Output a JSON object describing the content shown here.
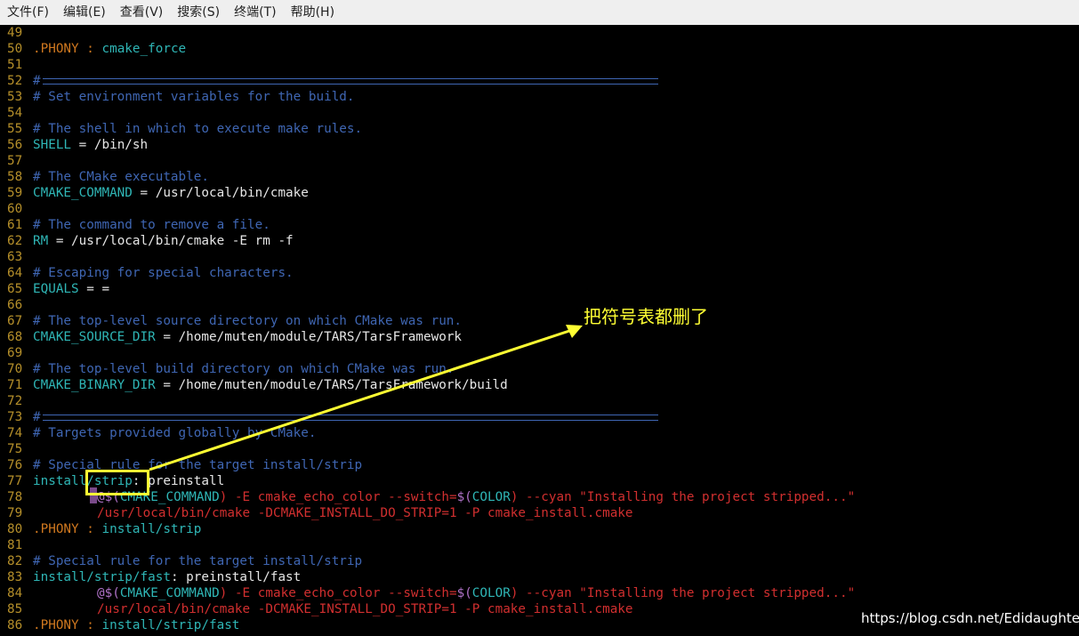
{
  "menubar": {
    "items": [
      "文件(F)",
      "编辑(E)",
      "查看(V)",
      "搜索(S)",
      "终端(T)",
      "帮助(H)"
    ]
  },
  "lines": {
    "l49": {
      "num": "49"
    },
    "l50": {
      "num": "50",
      "a": ".PHONY",
      "b": " : ",
      "c": "cmake_force"
    },
    "l51": {
      "num": "51"
    },
    "l52": {
      "num": "52",
      "a": "#"
    },
    "l53": {
      "num": "53",
      "a": "# Set environment variables for the build."
    },
    "l54": {
      "num": "54"
    },
    "l55": {
      "num": "55",
      "a": "# The shell in which to execute make rules."
    },
    "l56": {
      "num": "56",
      "a": "SHELL",
      "b": " = ",
      "c": "/bin/sh"
    },
    "l57": {
      "num": "57"
    },
    "l58": {
      "num": "58",
      "a": "# The CMake executable."
    },
    "l59": {
      "num": "59",
      "a": "CMAKE_COMMAND",
      "b": " = ",
      "c": "/usr/local/bin/cmake"
    },
    "l60": {
      "num": "60"
    },
    "l61": {
      "num": "61",
      "a": "# The command to remove a file."
    },
    "l62": {
      "num": "62",
      "a": "RM",
      "b": " = ",
      "c": "/usr/local/bin/cmake -E rm -f"
    },
    "l63": {
      "num": "63"
    },
    "l64": {
      "num": "64",
      "a": "# Escaping for special characters."
    },
    "l65": {
      "num": "65",
      "a": "EQUALS",
      "b": " = ",
      "c": "="
    },
    "l66": {
      "num": "66"
    },
    "l67": {
      "num": "67",
      "a": "# The top-level source directory on which CMake was run."
    },
    "l68": {
      "num": "68",
      "a": "CMAKE_SOURCE_DIR",
      "b": " = ",
      "c": "/home/muten/module/TARS/TarsFramework"
    },
    "l69": {
      "num": "69"
    },
    "l70": {
      "num": "70",
      "a": "# The top-level build directory on which CMake was run."
    },
    "l71": {
      "num": "71",
      "a": "CMAKE_BINARY_DIR",
      "b": " = ",
      "c": "/home/muten/module/TARS/TarsFramework/build"
    },
    "l72": {
      "num": "72"
    },
    "l73": {
      "num": "73",
      "a": "#"
    },
    "l74": {
      "num": "74",
      "a": "# Targets provided globally by CMake."
    },
    "l75": {
      "num": "75"
    },
    "l76": {
      "num": "76",
      "a": "# Special rule for the target install/strip"
    },
    "l77": {
      "num": "77",
      "a": "install/strip",
      "b": ": ",
      "c": "preinstall"
    },
    "l78": {
      "num": "78",
      "a": "@",
      "b": "$(",
      "c": "CMAKE_COMMAND",
      "d": ") -E cmake_echo_color --switch=",
      "e": "$(",
      "f": "COLOR",
      "g": ") --cyan \"Installing the project stripped...\""
    },
    "l79": {
      "num": "79",
      "a": "/usr/local/bin/cmake -DCMAKE_INSTALL_DO_STRIP=1 -P cmake_install.cmake"
    },
    "l80": {
      "num": "80",
      "a": ".PHONY",
      "b": " : ",
      "c": "install/strip"
    },
    "l81": {
      "num": "81"
    },
    "l82": {
      "num": "82",
      "a": "# Special rule for the target install/strip"
    },
    "l83": {
      "num": "83",
      "a": "install/strip/fast",
      "b": ": ",
      "c": "preinstall/fast"
    },
    "l84": {
      "num": "84",
      "a": "@",
      "b": "$(",
      "c": "CMAKE_COMMAND",
      "d": ") -E cmake_echo_color --switch=",
      "e": "$(",
      "f": "COLOR",
      "g": ") --cyan \"Installing the project stripped...\""
    },
    "l85": {
      "num": "85",
      "a": "/usr/local/bin/cmake -DCMAKE_INSTALL_DO_STRIP=1 -P cmake_install.cmake"
    },
    "l86": {
      "num": "86",
      "a": ".PHONY",
      "b": " : ",
      "c": "install/strip/fast"
    }
  },
  "annotation": {
    "text": "把符号表都删了",
    "color": "#ffff33"
  },
  "watermark": "https://blog.csdn.net/Edidaughter",
  "colors": {
    "background": "#000000",
    "line_number": "#b58f2a",
    "comment": "#3f66b3",
    "variable": "#2fb6b6",
    "phony": "#d0781f",
    "command_red": "#d12f2f",
    "highlight_box": "#ffff33"
  }
}
